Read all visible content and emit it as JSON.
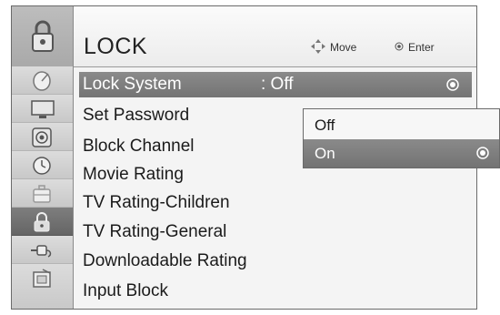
{
  "header": {
    "title": "LOCK",
    "hint_move": "Move",
    "hint_enter": "Enter",
    "icon": "padlock-icon"
  },
  "sidebar": {
    "items": [
      {
        "icon": "satellite-dish-icon",
        "active": false
      },
      {
        "icon": "monitor-icon",
        "active": false
      },
      {
        "icon": "speaker-icon",
        "active": false
      },
      {
        "icon": "clock-icon",
        "active": false
      },
      {
        "icon": "briefcase-icon",
        "active": false
      },
      {
        "icon": "padlock-icon",
        "active": true
      },
      {
        "icon": "plug-icon",
        "active": false
      },
      {
        "icon": "support-icon",
        "active": false
      }
    ]
  },
  "menu": {
    "items": [
      {
        "label": "Lock System",
        "value": ": Off",
        "selected": true
      },
      {
        "label": "Set Password"
      },
      {
        "label": "Block Channel"
      },
      {
        "label": "Movie Rating"
      },
      {
        "label": "TV Rating-Children"
      },
      {
        "label": "TV Rating-General"
      },
      {
        "label": "Downloadable Rating"
      },
      {
        "label": "Input Block"
      }
    ]
  },
  "dropdown": {
    "options": [
      {
        "label": "Off",
        "selected": false
      },
      {
        "label": "On",
        "selected": true
      }
    ]
  },
  "colors": {
    "highlight": "#7e7e7e",
    "sidebar_active": "#6e6e6e",
    "panel_bg": "#f4f4f4"
  }
}
